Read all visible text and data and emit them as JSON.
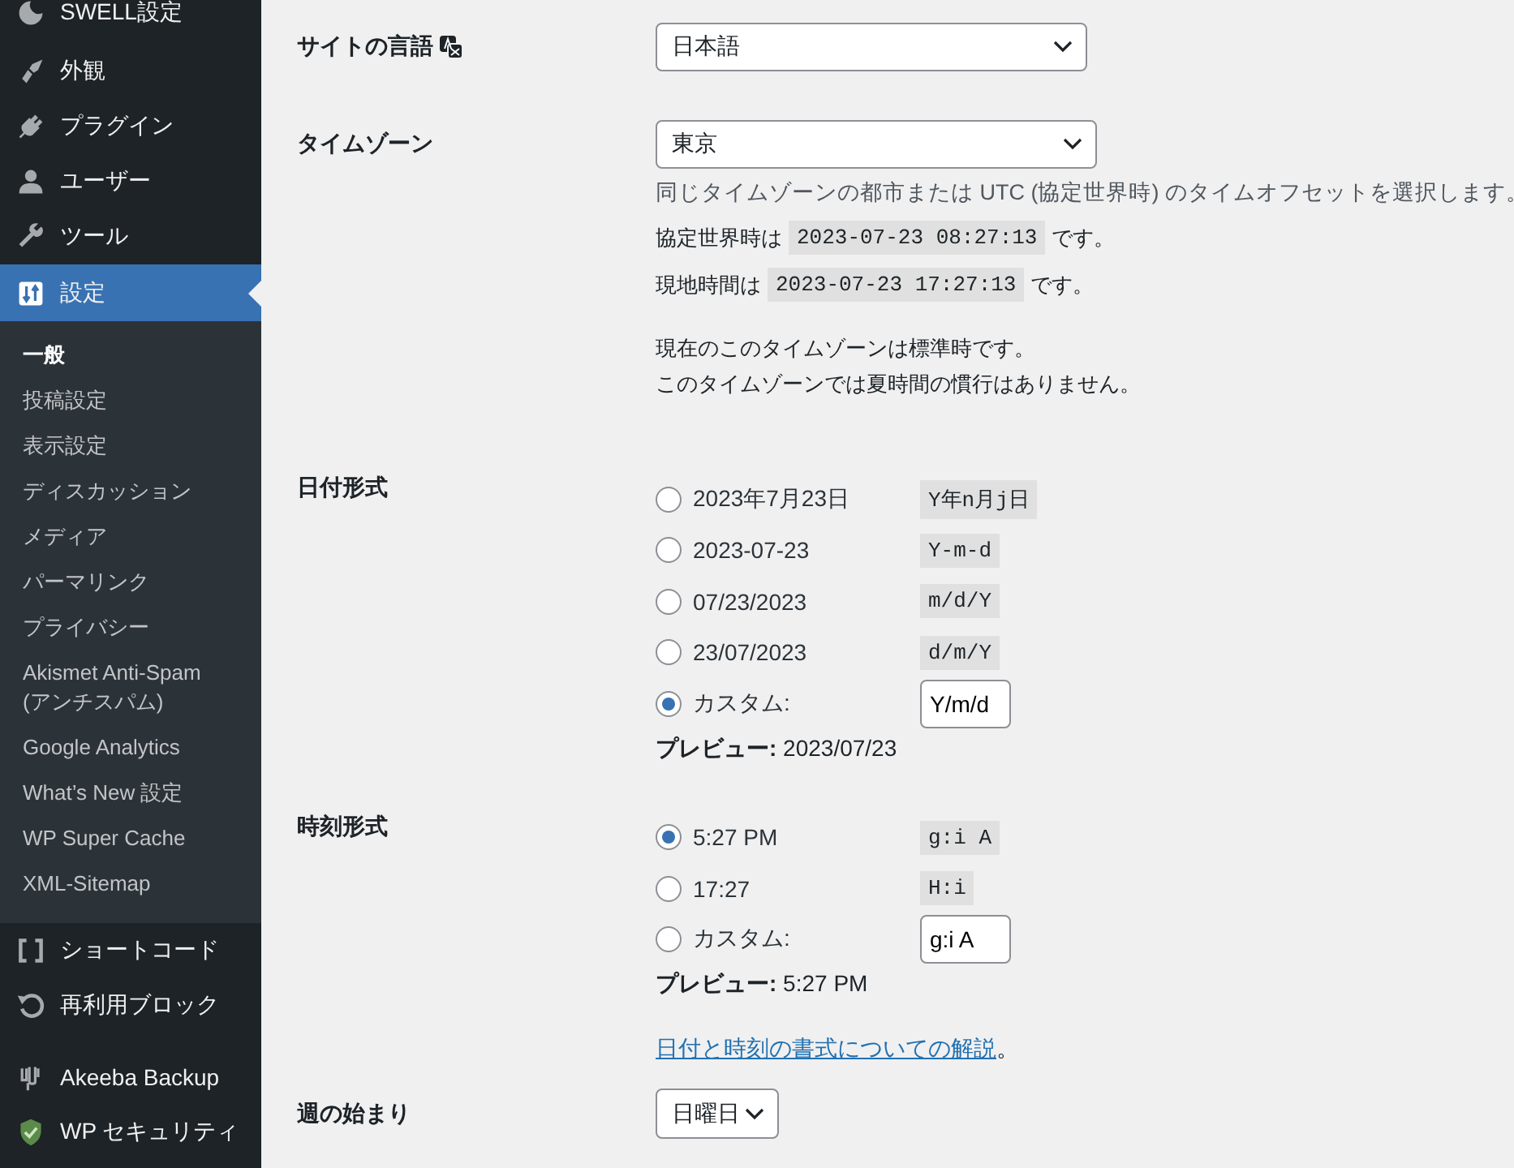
{
  "sidebar": {
    "menu": [
      {
        "label": "SWELL設定",
        "selected": false
      },
      {
        "label": "外観",
        "selected": false
      },
      {
        "label": "プラグイン",
        "selected": false
      },
      {
        "label": "ユーザー",
        "selected": false
      },
      {
        "label": "ツール",
        "selected": false
      },
      {
        "label": "設定",
        "selected": true,
        "children": [
          {
            "label": "一般",
            "selected": true
          },
          {
            "label": "投稿設定",
            "selected": false
          },
          {
            "label": "表示設定",
            "selected": false
          },
          {
            "label": "ディスカッション",
            "selected": false
          },
          {
            "label": "メディア",
            "selected": false
          },
          {
            "label": "パーマリンク",
            "selected": false
          },
          {
            "label": "プライバシー",
            "selected": false
          },
          {
            "label": "Akismet Anti-Spam (アンチスパム)",
            "selected": false
          },
          {
            "label": "Google Analytics",
            "selected": false
          },
          {
            "label": "What’s New 設定",
            "selected": false
          },
          {
            "label": "WP Super Cache",
            "selected": false
          },
          {
            "label": "XML-Sitemap",
            "selected": false
          }
        ]
      },
      {
        "label": "ショートコード",
        "selected": false
      },
      {
        "label": "再利用ブロック",
        "selected": false
      },
      {
        "label": "Akeeba Backup",
        "selected": false
      },
      {
        "label": "WP セキュリティ",
        "selected": false
      }
    ]
  },
  "settings": {
    "language": {
      "label": "サイトの言語",
      "value": "日本語"
    },
    "timezone": {
      "label": "タイムゾーン",
      "value": "東京",
      "description": "同じタイムゾーンの都市または UTC (協定世界時) のタイムオフセットを選択します。",
      "times": [
        {
          "prefix": "協定世界時は",
          "code": "2023-07-23 08:27:13",
          "suffix": "です。"
        },
        {
          "prefix": "現地時間は",
          "code": "2023-07-23 17:27:13",
          "suffix": "です。"
        }
      ],
      "notes": [
        "現在のこのタイムゾーンは標準時です。",
        "このタイムゾーンでは夏時間の慣行はありません。"
      ]
    },
    "date_format": {
      "label": "日付形式",
      "options": [
        {
          "kind": "preset",
          "label": "2023年7月23日",
          "code": "Y年n月j日",
          "selected": false
        },
        {
          "kind": "preset",
          "label": "2023-07-23",
          "code": "Y-m-d",
          "selected": false
        },
        {
          "kind": "preset",
          "label": "07/23/2023",
          "code": "m/d/Y",
          "selected": false
        },
        {
          "kind": "preset",
          "label": "23/07/2023",
          "code": "d/m/Y",
          "selected": false
        },
        {
          "kind": "custom",
          "label": "カスタム:",
          "value": "Y/m/d",
          "selected": true
        }
      ],
      "preview": "**プレビュー:** 2023/07/23"
    },
    "time_format": {
      "label": "時刻形式",
      "options": [
        {
          "kind": "preset",
          "label": "5:27 PM",
          "code": "g:i A",
          "selected": true
        },
        {
          "kind": "preset",
          "label": "17:27",
          "code": "H:i",
          "selected": false
        },
        {
          "kind": "custom",
          "label": "カスタム:",
          "value": "g:i A",
          "selected": false
        }
      ],
      "preview": "**プレビュー:** 5:27 PM",
      "link": "日付と時刻の書式についての解説",
      "link_suffix": "。"
    },
    "week_start": {
      "label": "週の始まり",
      "value": "日曜日"
    }
  }
}
